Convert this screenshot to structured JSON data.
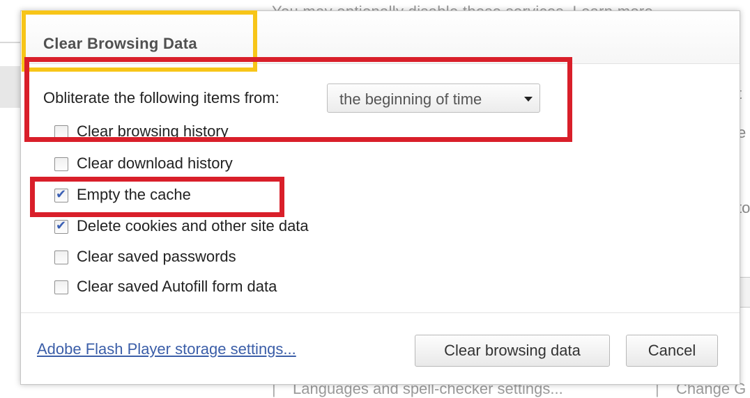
{
  "background": {
    "top_text": "You may optionally disable these services. Learn more",
    "bottom_text": "Languages and spell-checker settings...",
    "bottom_right_text": "Change G",
    "right_fragments": [
      "t",
      "e",
      "to",
      "e"
    ]
  },
  "dialog": {
    "title": "Clear Browsing Data",
    "obliterate_label": "Obliterate the following items from:",
    "time_range": {
      "selected": "the beginning of time"
    },
    "options": [
      {
        "label": "Clear browsing history",
        "checked": false
      },
      {
        "label": "Clear download history",
        "checked": false
      },
      {
        "label": "Empty the cache",
        "checked": true
      },
      {
        "label": "Delete cookies and other site data",
        "checked": true
      },
      {
        "label": "Clear saved passwords",
        "checked": false
      },
      {
        "label": "Clear saved Autofill form data",
        "checked": false
      }
    ],
    "flash_link": "Adobe Flash Player storage settings...",
    "clear_button": "Clear browsing data",
    "cancel_button": "Cancel"
  },
  "colors": {
    "highlight_yellow": "#f7c519",
    "highlight_red": "#d91f2a",
    "link": "#3b5ea8"
  }
}
